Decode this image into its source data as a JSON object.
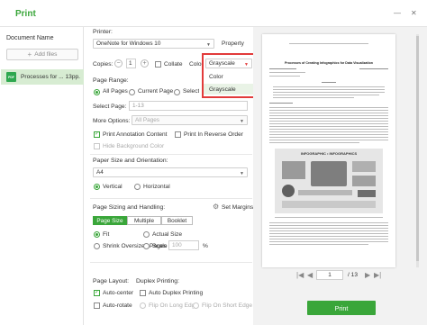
{
  "window": {
    "title": "Print",
    "minimize_glyph": "—",
    "close_glyph": "✕"
  },
  "left_pane": {
    "heading": "Document Name",
    "add_files_icon": "plus-icon",
    "add_files_label": "Add files",
    "files": [
      {
        "icon_label": "PDF",
        "name": "Processes for ...",
        "pages": "13pp."
      }
    ]
  },
  "printer": {
    "label": "Printer:",
    "selected": "OneNote for Windows 10",
    "property_label": "Property"
  },
  "copies": {
    "label": "Copies:",
    "value": "1",
    "collate_label": "Collate",
    "collate_checked": false
  },
  "color": {
    "label": "Color:",
    "selected": "Grayscale",
    "options": [
      "Color",
      "Grayscale"
    ],
    "highlight_color": "#e23b3b"
  },
  "page_range": {
    "label": "Page Range:",
    "options": [
      "All Pages",
      "Current Page",
      "Selection"
    ],
    "selected": "All Pages",
    "select_page_label": "Select Page:",
    "select_page_placeholder": "1-13",
    "more_options_label": "More Options:",
    "more_options_value": "All Pages"
  },
  "annotations": {
    "print_annotation_label": "Print Annotation Content",
    "print_annotation_checked": true,
    "reverse_order_label": "Print In Reverse Order",
    "reverse_order_checked": false,
    "hide_background_label": "Hide Background Color",
    "hide_background_checked": false
  },
  "paper": {
    "label": "Paper Size and Orientation:",
    "size": "A4",
    "orientations": [
      "Vertical",
      "Horizontal"
    ],
    "orientation_selected": "Vertical"
  },
  "sizing": {
    "label": "Page Sizing and Handling:",
    "set_margins_label": "Set Margins",
    "tabs": [
      "Page Size",
      "Multiple",
      "Booklet"
    ],
    "active_tab": "Page Size",
    "fit_label": "Fit",
    "actual_size_label": "Actual Size",
    "shrink_label": "Shrink Oversized Pages",
    "scale_label": "Scale",
    "scale_value": "100",
    "scale_unit": "%",
    "selected": "Fit"
  },
  "layout": {
    "page_layout_label": "Page Layout:",
    "duplex_label": "Duplex Printing:",
    "auto_center_label": "Auto-center",
    "auto_center_checked": true,
    "auto_duplex_label": "Auto Duplex Printing",
    "auto_duplex_checked": false,
    "auto_rotate_label": "Auto-rotate",
    "auto_rotate_checked": false,
    "flip_long_label": "Flip On Long Edge",
    "flip_short_label": "Flip On Short Edge"
  },
  "preview": {
    "page_value": "1",
    "total": "/ 13",
    "print_label": "Print",
    "doc_title": "Processes of Creating Infographics for Data Visualization",
    "figure_title": "INFOGRAPHIC • INFOGRAPHICS"
  },
  "colors": {
    "accent": "#3aa63a",
    "selected_row": "#d7ecd2"
  }
}
